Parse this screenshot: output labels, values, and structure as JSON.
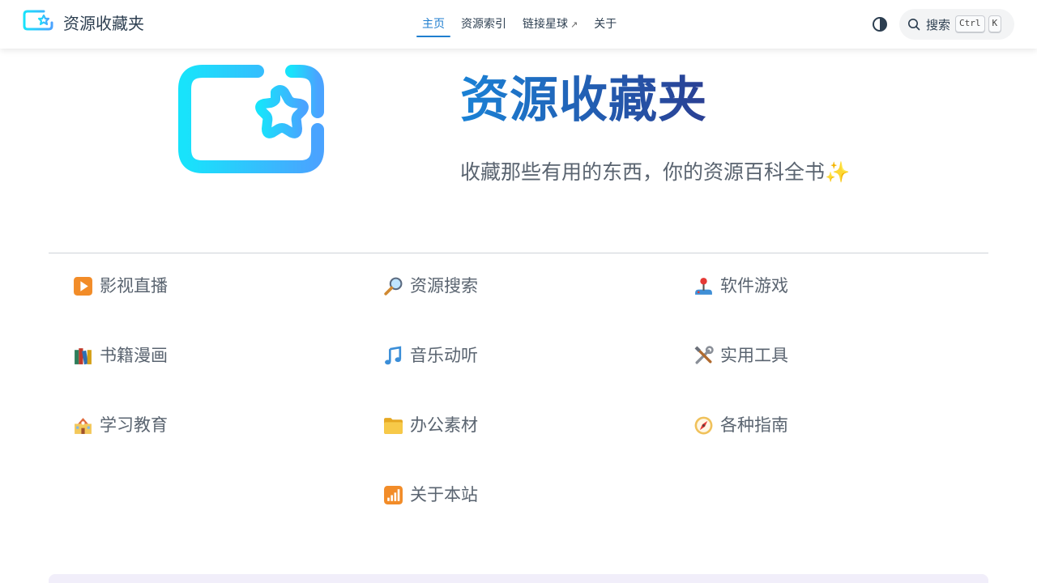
{
  "navbar": {
    "site_name": "资源收藏夹",
    "links": [
      {
        "label": "主页",
        "active": true,
        "external": false
      },
      {
        "label": "资源索引",
        "active": false,
        "external": false
      },
      {
        "label": "链接星球",
        "active": false,
        "external": true,
        "external_icon": "↗"
      },
      {
        "label": "关于",
        "active": false,
        "external": false
      }
    ],
    "search": {
      "label": "搜索",
      "shortcut_keys": [
        "Ctrl",
        "K"
      ]
    }
  },
  "hero": {
    "title": "资源收藏夹",
    "description": "收藏那些有用的东西，你的资源百科全书✨"
  },
  "categories": [
    {
      "label": "影视直播",
      "icon": "play-button-icon"
    },
    {
      "label": "资源搜索",
      "icon": "magnifier-icon"
    },
    {
      "label": "软件游戏",
      "icon": "joystick-icon"
    },
    {
      "label": "书籍漫画",
      "icon": "books-icon"
    },
    {
      "label": "音乐动听",
      "icon": "music-note-icon"
    },
    {
      "label": "实用工具",
      "icon": "tools-icon"
    },
    {
      "label": "学习教育",
      "icon": "school-icon"
    },
    {
      "label": "办公素材",
      "icon": "folder-icon"
    },
    {
      "label": "各种指南",
      "icon": "compass-icon"
    },
    {
      "label": "关于本站",
      "icon": "signal-bars-icon"
    }
  ],
  "colors": {
    "accent": "#1f7ecf",
    "logo_gradient_start": "#18e3fb",
    "logo_gradient_end": "#4aa3ff",
    "title_gradient_start": "#1a82d6",
    "title_gradient_end": "#2a3f93"
  }
}
